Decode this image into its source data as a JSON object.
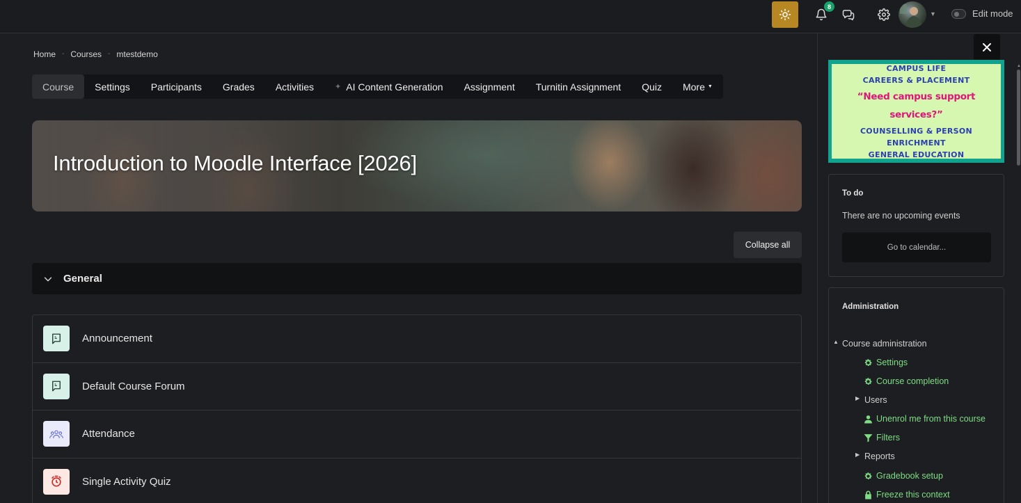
{
  "navbar": {
    "notification_count": "8",
    "edit_mode_label": "Edit mode",
    "colors": {
      "theme_button": "#b68723",
      "badge": "#1aa06a"
    }
  },
  "breadcrumb": [
    "Home",
    "Courses",
    "mtestdemo"
  ],
  "tabs": [
    {
      "label": "Course",
      "active": true
    },
    {
      "label": "Settings"
    },
    {
      "label": "Participants"
    },
    {
      "label": "Grades"
    },
    {
      "label": "Activities"
    },
    {
      "label": "AI Content Generation",
      "icon": "sparkle-icon"
    },
    {
      "label": "Assignment"
    },
    {
      "label": "Turnitin Assignment"
    },
    {
      "label": "Quiz"
    },
    {
      "label": "More"
    }
  ],
  "hero": {
    "title": "Introduction to Moodle Interface [2026]"
  },
  "collapse_all_label": "Collapse all",
  "section": {
    "title": "General"
  },
  "activities": [
    {
      "name": "Announcement",
      "icon": "forum-icon",
      "icon_bg": "#d8f1e8"
    },
    {
      "name": "Default Course Forum",
      "icon": "forum-icon",
      "icon_bg": "#d8f1e8"
    },
    {
      "name": "Attendance",
      "icon": "attendance-icon",
      "icon_bg": "#e9ebfa"
    },
    {
      "name": "Single Activity Quiz",
      "icon": "quiz-icon",
      "icon_bg": "#fde8e4"
    }
  ],
  "banner": {
    "line1": "CAMPUS LIFE",
    "line2": "CAREERS & PLACEMENT",
    "quote": "“Need campus support services?”",
    "line3": "COUNSELLING & PERSON ENRICHMENT",
    "line4": "GENERAL EDUCATION"
  },
  "todo": {
    "title": "To do",
    "empty_text": "There are no upcoming events",
    "calendar_button": "Go to calendar..."
  },
  "administration": {
    "title": "Administration",
    "course_admin": "Course administration",
    "items": {
      "settings": "Settings",
      "course_completion": "Course completion",
      "users": "Users",
      "unenrol": "Unenrol me from this course",
      "filters": "Filters",
      "reports": "Reports",
      "gradebook_setup": "Gradebook setup",
      "freeze": "Freeze this context"
    },
    "link_color": "#7edd84"
  }
}
